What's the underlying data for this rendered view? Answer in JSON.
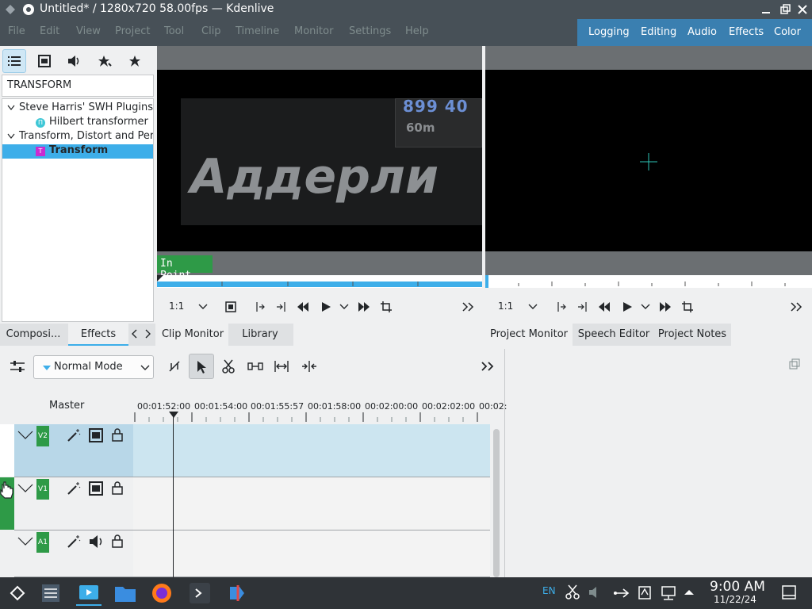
{
  "window": {
    "title": "Untitled* / 1280x720 58.00fps — Kdenlive"
  },
  "menu": [
    "File",
    "Edit",
    "View",
    "Project",
    "Tool",
    "Clip",
    "Timeline",
    "Monitor",
    "Settings",
    "Help"
  ],
  "workspaces": [
    "Logging",
    "Editing",
    "Audio",
    "Effects",
    "Color"
  ],
  "effects_panel": {
    "search_value": "TRANSFORM",
    "tree": [
      {
        "label": "Steve Harris' SWH Plugins",
        "type": "group"
      },
      {
        "label": "Hilbert transformer",
        "type": "item",
        "badge": "Π"
      },
      {
        "label": "Transform, Distort and Pers",
        "type": "group"
      },
      {
        "label": "Transform",
        "type": "item",
        "badge": "T",
        "selected": true
      }
    ],
    "tabs": [
      "Composi...",
      "Effects"
    ]
  },
  "clip_monitor": {
    "overlay_text": "Аддерли",
    "hud_numbers": "899 40",
    "hud_sub": "60m",
    "in_point_label": "In Point",
    "zoom": "1:1",
    "tabs": [
      "Clip Monitor",
      "Library"
    ]
  },
  "project_monitor": {
    "zoom": "1:1",
    "tabs": [
      "Project Monitor",
      "Speech Editor",
      "Project Notes"
    ]
  },
  "timeline": {
    "mode": "Normal Mode",
    "master_label": "Master",
    "timecodes": [
      "00:01:52:00",
      "00:01:54:00",
      "00:01:55:57",
      "00:01:58:00",
      "00:02:00:00",
      "00:02:02:00",
      "00:02:"
    ],
    "tracks": [
      {
        "name": "V2",
        "kind": "video"
      },
      {
        "name": "V1",
        "kind": "video"
      },
      {
        "name": "A1",
        "kind": "audio"
      }
    ]
  },
  "taskbar": {
    "time": "9:00 AM",
    "date": "11/22/24"
  },
  "colors": {
    "accent": "#3daee9",
    "titlebar": "#475057",
    "workspace_bar": "#3a7fb0",
    "track_badge": "#2e9a47",
    "in_point": "#2e9a47"
  }
}
